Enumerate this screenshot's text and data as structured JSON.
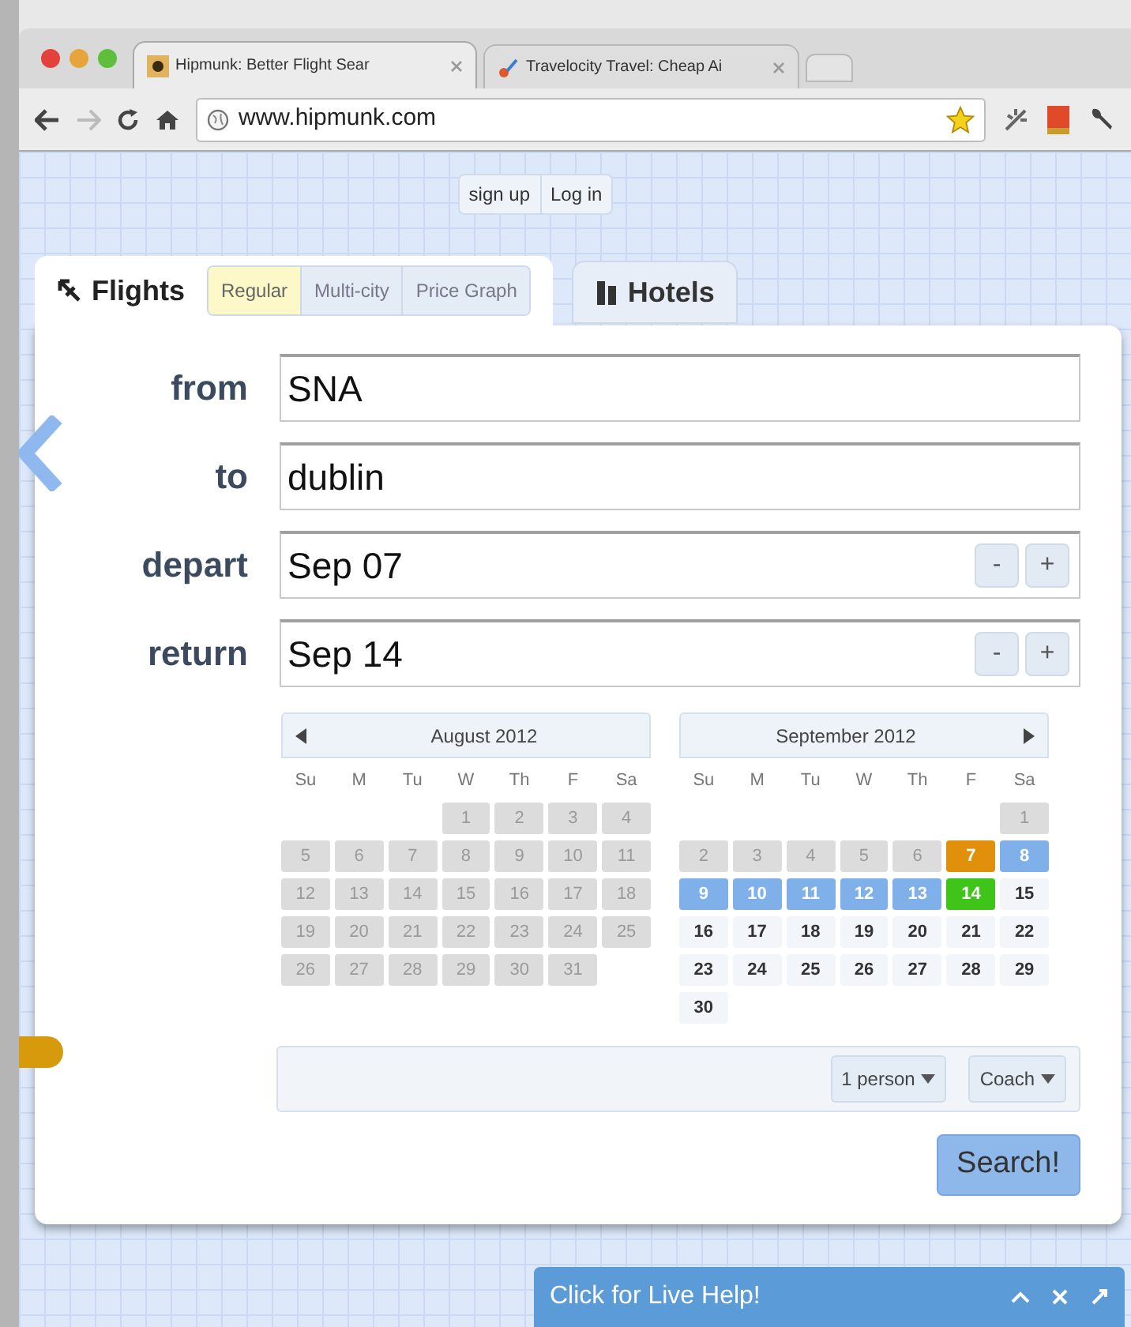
{
  "browser": {
    "tabs": [
      {
        "title": "Hipmunk: Better Flight Sear",
        "selected": true
      },
      {
        "title": "Travelocity Travel: Cheap Ai",
        "selected": false
      }
    ],
    "address": "www.hipmunk.com",
    "bookmarked": true
  },
  "account_links": [
    "sign up",
    "Log in"
  ],
  "search_tabs": [
    {
      "label": "Flights",
      "kind": "flights",
      "selected": true,
      "modes": [
        {
          "label": "Regular",
          "selected": true
        },
        {
          "label": "Multi-city",
          "selected": false
        },
        {
          "label": "Price Graph",
          "selected": false
        }
      ]
    },
    {
      "label": "Hotels",
      "kind": "hotels",
      "selected": false
    }
  ],
  "fields": [
    {
      "label": "from",
      "value": "SNA",
      "stepper": false
    },
    {
      "label": "to",
      "value": "dublin",
      "stepper": false
    },
    {
      "label": "depart",
      "value": "Sep 07",
      "stepper": true,
      "minus": "-",
      "plus": "+"
    },
    {
      "label": "return",
      "value": "Sep 14",
      "stepper": true,
      "minus": "-",
      "plus": "+"
    }
  ],
  "calendars": [
    {
      "title": "August 2012",
      "prev_arrow": true,
      "next_arrow": false,
      "weekdays": [
        "Su",
        "M",
        "Tu",
        "W",
        "Th",
        "F",
        "Sa"
      ],
      "weeks": [
        [
          {
            "day": "1",
            "kind": "past"
          },
          {
            "day": "2",
            "kind": "past"
          },
          {
            "day": "3",
            "kind": "past"
          },
          {
            "day": "4",
            "kind": "past"
          }
        ],
        [
          {
            "day": "5",
            "kind": "past"
          },
          {
            "day": "6",
            "kind": "past"
          },
          {
            "day": "7",
            "kind": "past"
          },
          {
            "day": "8",
            "kind": "past"
          },
          {
            "day": "9",
            "kind": "past"
          },
          {
            "day": "10",
            "kind": "past"
          },
          {
            "day": "11",
            "kind": "past"
          }
        ],
        [
          {
            "day": "12",
            "kind": "past"
          },
          {
            "day": "13",
            "kind": "past"
          },
          {
            "day": "14",
            "kind": "past"
          },
          {
            "day": "15",
            "kind": "past"
          },
          {
            "day": "16",
            "kind": "past"
          },
          {
            "day": "17",
            "kind": "past"
          },
          {
            "day": "18",
            "kind": "past"
          }
        ],
        [
          {
            "day": "19",
            "kind": "past"
          },
          {
            "day": "20",
            "kind": "past"
          },
          {
            "day": "21",
            "kind": "past"
          },
          {
            "day": "22",
            "kind": "past"
          },
          {
            "day": "23",
            "kind": "past"
          },
          {
            "day": "24",
            "kind": "past"
          },
          {
            "day": "25",
            "kind": "past"
          }
        ],
        [
          {
            "day": "26",
            "kind": "past"
          },
          {
            "day": "27",
            "kind": "past"
          },
          {
            "day": "28",
            "kind": "past"
          },
          {
            "day": "29",
            "kind": "past"
          },
          {
            "day": "30",
            "kind": "past"
          },
          {
            "day": "31",
            "kind": "past"
          }
        ]
      ]
    },
    {
      "title": "September 2012",
      "prev_arrow": false,
      "next_arrow": true,
      "weekdays": [
        "Su",
        "M",
        "Tu",
        "W",
        "Th",
        "F",
        "Sa"
      ],
      "weeks": [
        [
          {
            "day": "1",
            "kind": "past"
          }
        ],
        [
          {
            "day": "2",
            "kind": "past"
          },
          {
            "day": "3",
            "kind": "past"
          },
          {
            "day": "4",
            "kind": "past"
          },
          {
            "day": "5",
            "kind": "past"
          },
          {
            "day": "6",
            "kind": "past"
          },
          {
            "day": "7",
            "kind": "depart"
          },
          {
            "day": "8",
            "kind": "range"
          }
        ],
        [
          {
            "day": "9",
            "kind": "range"
          },
          {
            "day": "10",
            "kind": "range"
          },
          {
            "day": "11",
            "kind": "range"
          },
          {
            "day": "12",
            "kind": "range"
          },
          {
            "day": "13",
            "kind": "range"
          },
          {
            "day": "14",
            "kind": "return"
          },
          {
            "day": "15",
            "kind": "open"
          }
        ],
        [
          {
            "day": "16",
            "kind": "open"
          },
          {
            "day": "17",
            "kind": "open"
          },
          {
            "day": "18",
            "kind": "open"
          },
          {
            "day": "19",
            "kind": "open"
          },
          {
            "day": "20",
            "kind": "open"
          },
          {
            "day": "21",
            "kind": "open"
          },
          {
            "day": "22",
            "kind": "open"
          }
        ],
        [
          {
            "day": "23",
            "kind": "open"
          },
          {
            "day": "24",
            "kind": "open"
          },
          {
            "day": "25",
            "kind": "open"
          },
          {
            "day": "26",
            "kind": "open"
          },
          {
            "day": "27",
            "kind": "open"
          },
          {
            "day": "28",
            "kind": "open"
          },
          {
            "day": "29",
            "kind": "open"
          }
        ],
        [
          {
            "day": "30",
            "kind": "open"
          }
        ]
      ]
    }
  ],
  "options": [
    "1 person",
    "Coach"
  ],
  "search_button": "Search!",
  "live_help": {
    "label": "Click for Live Help!"
  }
}
